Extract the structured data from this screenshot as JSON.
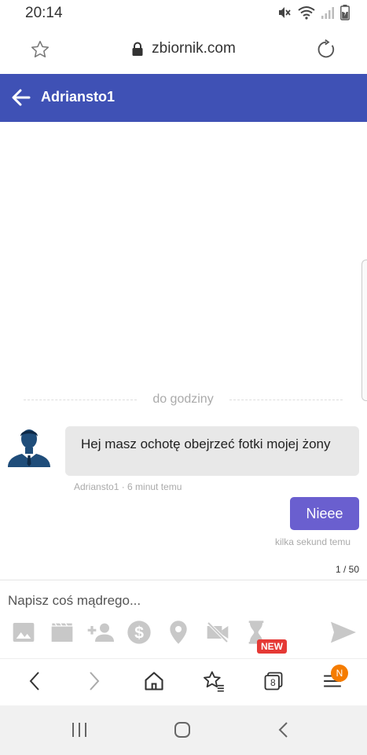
{
  "status_bar": {
    "time": "20:14",
    "icons": [
      "mute-icon",
      "wifi-icon",
      "signal-icon",
      "battery-icon"
    ]
  },
  "browser": {
    "url": "zbiornik.com",
    "icons": [
      "star-icon",
      "lock-icon",
      "reload-icon"
    ]
  },
  "header": {
    "title": "Adriansto1",
    "background": "#3f51b5"
  },
  "chat": {
    "divider_label": "do godziny",
    "messages": [
      {
        "direction": "incoming",
        "text": "Hej masz ochotę obejrzeć fotki mojej żony",
        "meta": "Adriansto1 · 6 minut temu"
      },
      {
        "direction": "outgoing",
        "text": "Nieee",
        "meta": "kilka sekund temu"
      }
    ],
    "counter": "1 / 50",
    "outgoing_color": "#6a5fcf"
  },
  "composer": {
    "placeholder": "Napisz coś mądrego...",
    "new_badge": "NEW",
    "tools": [
      "image-icon",
      "video-icon",
      "add-friend-icon",
      "coins-icon",
      "location-icon",
      "videocam-off-icon",
      "hourglass-icon",
      "send-icon"
    ]
  },
  "browser_nav": {
    "tabs_count": "8",
    "notification_badge": "N",
    "items": [
      "back-icon",
      "forward-icon",
      "home-icon",
      "bookmarks-icon",
      "tabs-icon",
      "menu-icon"
    ]
  }
}
